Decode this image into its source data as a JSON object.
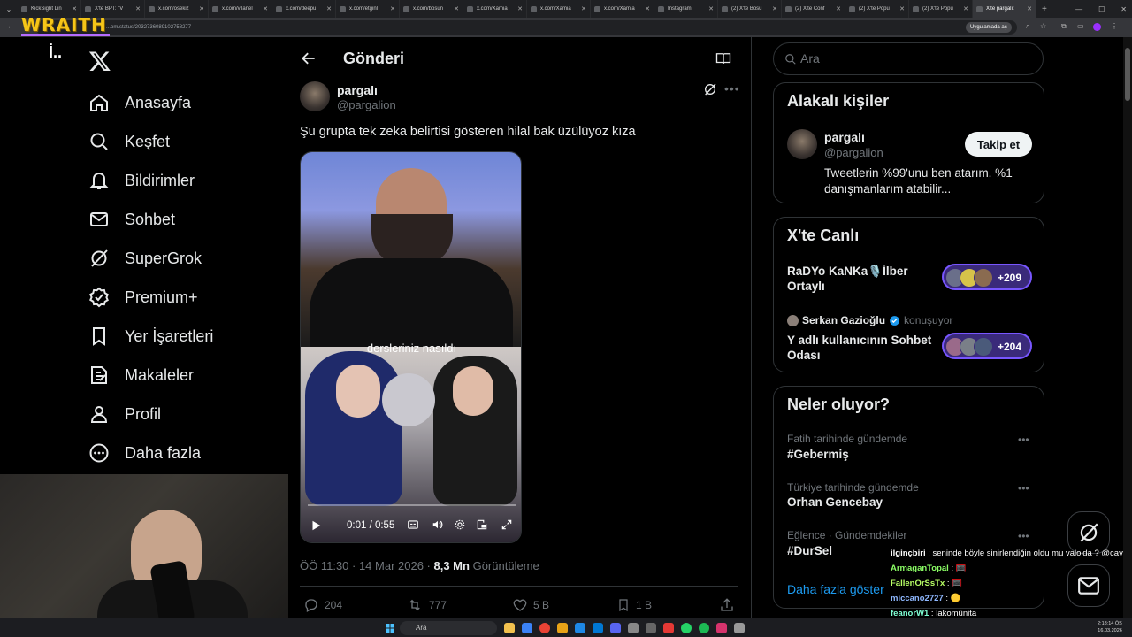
{
  "browser": {
    "tabs": [
      {
        "label": "KickSight Lin"
      },
      {
        "label": "X'te BPT: \"V"
      },
      {
        "label": "x.com/osekiz"
      },
      {
        "label": "x.com/vilanel"
      },
      {
        "label": "x.com/deepu"
      },
      {
        "label": "x.com/etginl"
      },
      {
        "label": "x.com/bosun"
      },
      {
        "label": "x.com/Xamia"
      },
      {
        "label": "x.com/Xamia"
      },
      {
        "label": "x.com/Xamia"
      },
      {
        "label": "Instagram"
      },
      {
        "label": "(2) X'te Bosu"
      },
      {
        "label": "(2) X'te Conf"
      },
      {
        "label": "(2) X'te Popu"
      },
      {
        "label": "(2) X'te Popu"
      },
      {
        "label": "X'te pargalı:"
      }
    ],
    "url": "...om/status/2032736089102758277",
    "app_chip": "Uygulamada aç",
    "overlay_logo": "WRAITH"
  },
  "sidebar": {
    "marker": "İ..",
    "items": [
      {
        "label": "Anasayfa",
        "icon": "home-icon"
      },
      {
        "label": "Keşfet",
        "icon": "search-icon"
      },
      {
        "label": "Bildirimler",
        "icon": "bell-icon"
      },
      {
        "label": "Sohbet",
        "icon": "mail-icon"
      },
      {
        "label": "SuperGrok",
        "icon": "grok-icon"
      },
      {
        "label": "Premium+",
        "icon": "verified-icon"
      },
      {
        "label": "Yer İşaretleri",
        "icon": "bookmark-icon"
      },
      {
        "label": "Makaleler",
        "icon": "article-icon"
      },
      {
        "label": "Profil",
        "icon": "person-icon"
      },
      {
        "label": "Daha fazla",
        "icon": "more-circle-icon"
      }
    ]
  },
  "post": {
    "page_title": "Gönderi",
    "author_name": "pargalı",
    "author_handle": "@pargalion",
    "text": "Şu grupta tek zeka belirtisi gösteren hilal bak üzülüyoz kıza",
    "video_caption": "dersleriniz nasıldı",
    "video_time": "0:01 / 0:55",
    "meta_time": "ÖÖ 11:30 · 14 Mar 2026 · ",
    "meta_views": "8,3 Mn",
    "meta_views_label": " Görüntüleme",
    "replies": "204",
    "reposts": "777",
    "likes": "5 B",
    "bookmarks": "1 B"
  },
  "search": {
    "placeholder": "Ara"
  },
  "related": {
    "title": "Alakalı kişiler",
    "name": "pargalı",
    "handle": "@pargalion",
    "follow_label": "Takip et",
    "bio": "Tweetlerin %99'unu ben atarım. %1 danışmanlarım atabilir..."
  },
  "live": {
    "title": "X'te Canlı",
    "spaces": [
      {
        "title": "RaDYo KaNKa🎙️İlber Ortaylı",
        "count": "+209"
      },
      {
        "title": "Y adlı kullanıcının Sohbet Odası",
        "count": "+204"
      }
    ],
    "host_name": "Serkan Gazioğlu",
    "host_status": "konuşuyor"
  },
  "trends": {
    "title": "Neler oluyor?",
    "items": [
      {
        "context": "Fatih tarihinde gündemde",
        "name": "#Gebermiş"
      },
      {
        "context": "Türkiye tarihinde gündemde",
        "name": "Orhan Gencebay"
      },
      {
        "context": "Eğlence · Gündemdekiler",
        "name": "#DurSel"
      }
    ],
    "show_more": "Daha fazla göster"
  },
  "chat": [
    {
      "user": "ilginçbiri",
      "color": "#ffffff",
      "text": " : seninde böyle sinirlendiğin oldu mu valo'da ? @cavs"
    },
    {
      "user": "ArmaganTopal",
      "color": "#8cff66",
      "text": " : 🥅"
    },
    {
      "user": "FallenOrSsTx",
      "color": "#b8ff66",
      "text": " : 🥅"
    },
    {
      "user": "miccano2727",
      "color": "#8fb8ff",
      "text": " : 🟡"
    },
    {
      "user": "feanorW1",
      "color": "#7fffd4",
      "text": " : lakomünita"
    }
  ],
  "taskbar": {
    "search_label": "Ara",
    "time": "2:18:14 ÖS",
    "date": "16.03.2026"
  },
  "colors": {
    "accent": "#1d9bf0",
    "live_purple": "#7856ff",
    "wraith_yellow": "#f5c518"
  }
}
